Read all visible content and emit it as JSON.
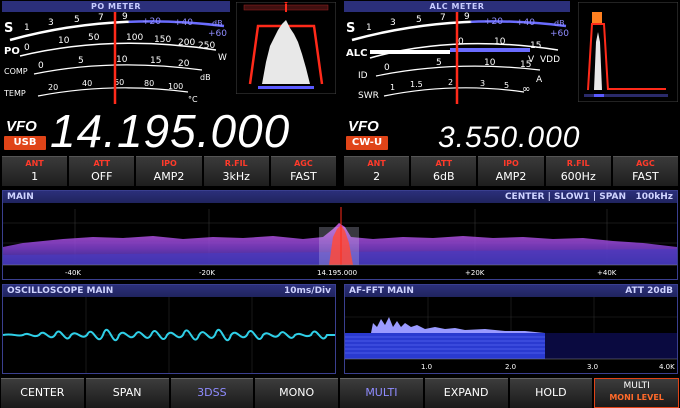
{
  "po_meter": {
    "title": "PO METER",
    "s_label": "S",
    "s_ticks": [
      "1",
      "3",
      "5",
      "7",
      "9"
    ],
    "s_plus": [
      "+20",
      "+40",
      "+60"
    ],
    "s_db": "dB",
    "po_label": "PO",
    "po_ticks": [
      "0",
      "10",
      "50",
      "100",
      "150",
      "200",
      "250"
    ],
    "po_unit": "W",
    "comp_label": "COMP",
    "comp_ticks": [
      "0",
      "5",
      "10",
      "15",
      "20"
    ],
    "comp_unit": "dB",
    "temp_label": "TEMP",
    "temp_ticks": [
      "20",
      "40",
      "60",
      "80",
      "100"
    ],
    "temp_unit": "°C"
  },
  "alc_meter": {
    "title": "ALC METER",
    "s_label": "S",
    "s_ticks": [
      "1",
      "3",
      "5",
      "7",
      "9"
    ],
    "s_plus": [
      "+20",
      "+40",
      "+60"
    ],
    "s_db": "dB",
    "alc_label": "ALC",
    "vdd_ticks": [
      "0",
      "10",
      "15"
    ],
    "vdd_unit": "VDD",
    "vdd_v": "V",
    "id_label": "ID",
    "id_ticks": [
      "0",
      "5",
      "10",
      "15"
    ],
    "id_unit": "A",
    "swr_label": "SWR",
    "swr_ticks": [
      "1",
      "1.5",
      "2",
      "3",
      "5"
    ],
    "swr_inf": "∞"
  },
  "vfo_main": {
    "label": "VFO",
    "mode": "USB",
    "frequency": "14.195.000",
    "params": [
      {
        "label": "ANT",
        "value": "1"
      },
      {
        "label": "ATT",
        "value": "OFF"
      },
      {
        "label": "IPO",
        "value": "AMP2"
      },
      {
        "label": "R.FIL",
        "value": "3kHz"
      },
      {
        "label": "AGC",
        "value": "FAST"
      }
    ]
  },
  "vfo_sub": {
    "label": "VFO",
    "mode": "CW-U",
    "frequency": "3.550.000",
    "params": [
      {
        "label": "ANT",
        "value": "2"
      },
      {
        "label": "ATT",
        "value": "6dB"
      },
      {
        "label": "IPO",
        "value": "AMP2"
      },
      {
        "label": "R.FIL",
        "value": "600Hz"
      },
      {
        "label": "AGC",
        "value": "FAST"
      }
    ]
  },
  "scope": {
    "title": "MAIN",
    "status": "CENTER | SLOW1 | SPAN   100kHz",
    "axis_labels": [
      "-40K",
      "-20K",
      "14.195.000",
      "+20K",
      "+40K"
    ]
  },
  "oscilloscope": {
    "title": "OSCILLOSCOPE MAIN",
    "timebase": "10ms/Div"
  },
  "affft": {
    "title": "AF-FFT MAIN",
    "att": "ATT 20dB",
    "axis_labels": [
      "1.0",
      "2.0",
      "3.0",
      "4.0K"
    ]
  },
  "buttons": [
    "CENTER",
    "SPAN",
    "3DSS",
    "MONO",
    "MULTI",
    "EXPAND",
    "HOLD"
  ],
  "multi_button": {
    "line1": "MULTI",
    "line2": "MONI LEVEL"
  },
  "colors": {
    "accent_red": "#e04418",
    "header_blue": "#2b2f7a",
    "trace_cyan": "#2fd0e8",
    "scope_magenta": "#d040e0"
  }
}
